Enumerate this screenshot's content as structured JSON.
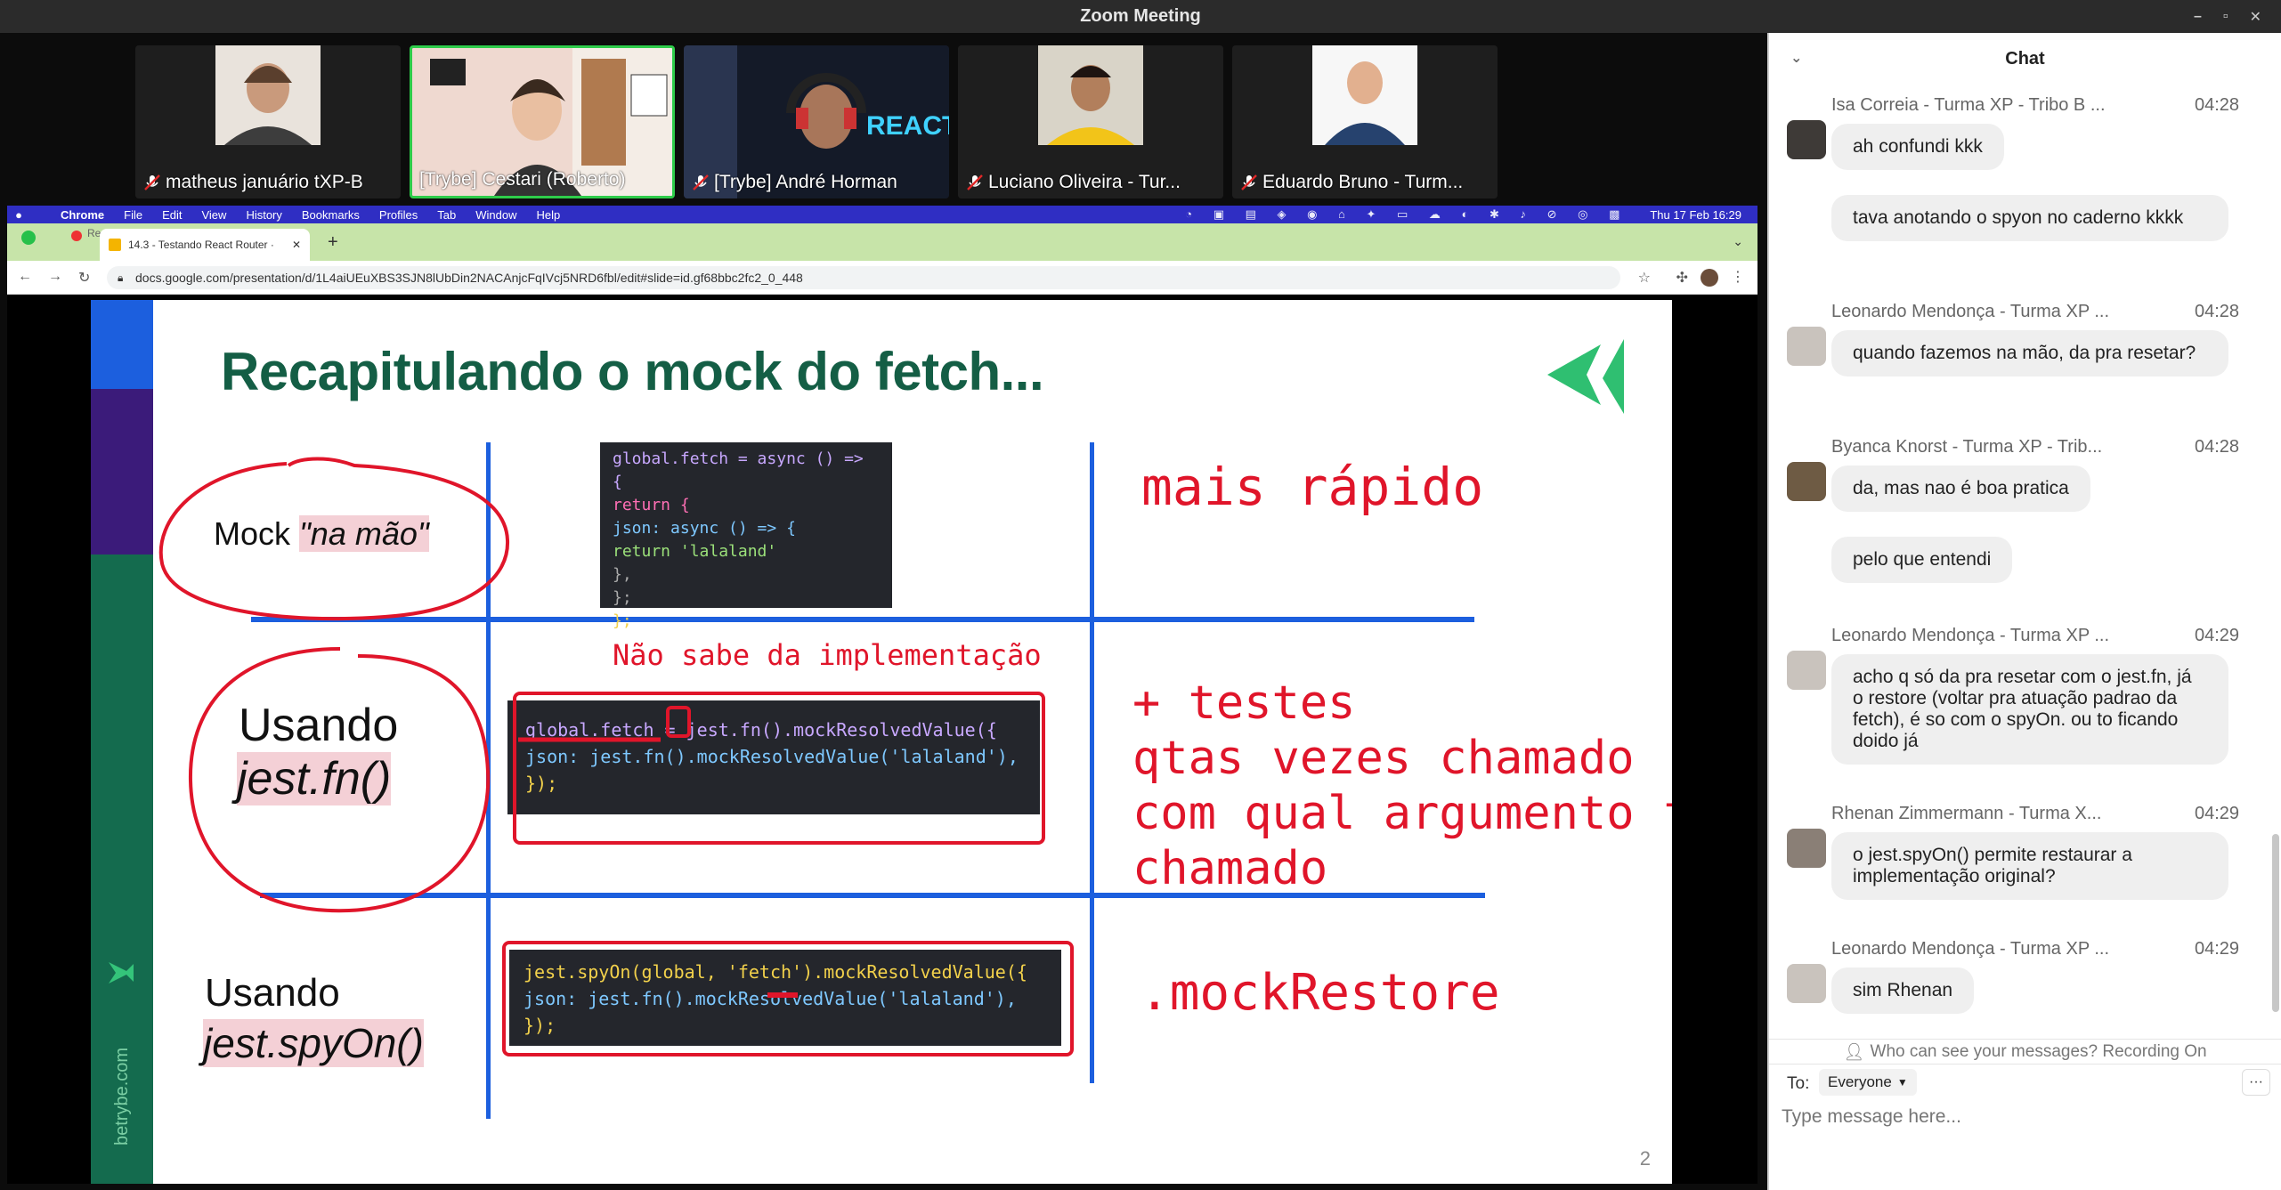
{
  "window": {
    "title": "Zoom Meeting",
    "controls": [
      "–",
      "▫",
      "✕"
    ]
  },
  "participants": [
    {
      "name": "matheus januário tXP-B",
      "muted": true,
      "active": false
    },
    {
      "name": "[Trybe] Cestari (Roberto)",
      "muted": false,
      "active": true
    },
    {
      "name": "[Trybe] André Horman",
      "muted": true,
      "active": false
    },
    {
      "name": "Luciano Oliveira - Tur...",
      "muted": true,
      "active": false
    },
    {
      "name": "Eduardo Bruno - Turm...",
      "muted": true,
      "active": false
    }
  ],
  "mac_menu": {
    "apple": "",
    "items": [
      "Chrome",
      "File",
      "Edit",
      "View",
      "History",
      "Bookmarks",
      "Profiles",
      "Tab",
      "Window",
      "Help"
    ],
    "clock": "Thu 17 Feb 16:29",
    "recording": "Recording"
  },
  "browser": {
    "tab_title": "14.3 - Testando React Router ·",
    "url": "docs.google.com/presentation/d/1L4aiUEuXBS3SJN8lUbDin2NACAnjcFqIVcj5NRD6fbl/edit#slide=id.gf68bbc2fc2_0_448"
  },
  "slide": {
    "title": "Recapitulando o mock do fetch...",
    "brand_text": "betrybe.com",
    "page_number": "2",
    "row1": {
      "label_a": "Mock ",
      "label_b": "\"na mão\"",
      "note": "mais rápido",
      "code": [
        "global.fetch = async () => {",
        "  return {",
        "    json: async () => {",
        "      return 'lalaland'",
        "    },",
        "  };",
        "};"
      ]
    },
    "row2": {
      "label_a": "Usando",
      "label_b": "jest.fn()",
      "annotation": "Não sabe da implementação",
      "notes": [
        "+ testes",
        "qtas vezes chamado",
        "com qual argumento foi",
        "chamado"
      ],
      "code": [
        "global.fetch = jest.fn().mockResolvedValue({",
        "  json: jest.fn().mockResolvedValue('lalaland'),",
        "});"
      ]
    },
    "row3": {
      "label_a": "Usando",
      "label_b": "jest.spyOn()",
      "note": ".mockRestore",
      "code": [
        "jest.spyOn(global, 'fetch').mockResolvedValue({",
        "  json: jest.fn().mockResolvedValue('lalaland'),",
        "});"
      ]
    }
  },
  "chat": {
    "title": "Chat",
    "messages": [
      {
        "sender": "Isa Correia - Turma XP - Tribo B ...",
        "time": "04:28",
        "bubbles": [
          "ah confundi kkk",
          "tava anotando o spyon no caderno kkkk"
        ]
      },
      {
        "sender": "Leonardo Mendonça - Turma XP ...",
        "time": "04:28",
        "bubbles": [
          "quando fazemos na mão, da pra resetar?"
        ]
      },
      {
        "sender": "Byanca Knorst - Turma XP - Trib...",
        "time": "04:28",
        "bubbles": [
          "da, mas nao é boa pratica",
          "pelo que entendi"
        ]
      },
      {
        "sender": "Leonardo Mendonça - Turma XP ...",
        "time": "04:29",
        "bubbles": [
          "acho q só da pra resetar com o jest.fn, já o restore (voltar pra atuação padrao da fetch), é so com o spyOn. ou to ficando doido já"
        ]
      },
      {
        "sender": "Rhenan Zimmermann - Turma X...",
        "time": "04:29",
        "bubbles": [
          "o jest.spyOn() permite restaurar a implementação original?"
        ]
      },
      {
        "sender": "Leonardo Mendonça - Turma XP ...",
        "time": "04:29",
        "bubbles": [
          "sim Rhenan"
        ]
      }
    ],
    "visibility_note": "Who can see your messages? Recording On",
    "to_label": "To:",
    "to_value": "Everyone",
    "more": "···",
    "input_placeholder": "Type message here..."
  }
}
